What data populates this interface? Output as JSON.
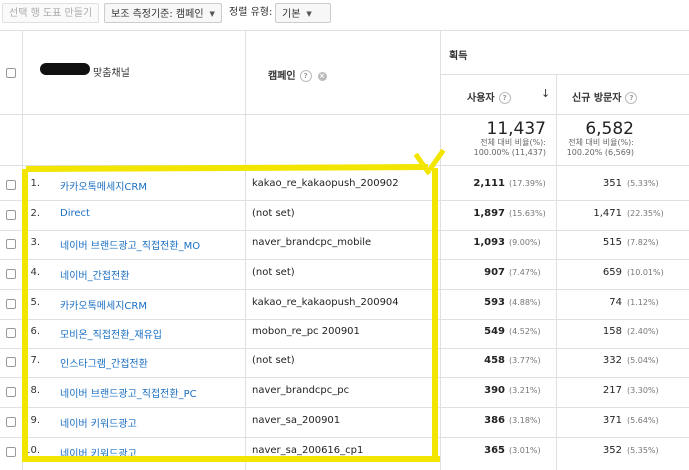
{
  "toolbar": {
    "make_chart_label": "선택 행 도표 만들기",
    "secondary_dimension_label": "보조 측정기준: 캠페인",
    "sort_type_label": "정렬 유형:",
    "sort_type_value": "기본"
  },
  "header": {
    "group_label": "획득",
    "col_channel": "맞춤채널",
    "col_campaign": "캠페인",
    "col_users": "사용자",
    "col_new_visitors": "신규 방문자"
  },
  "totals": {
    "users_value": "11,437",
    "users_line1": "전체 대비 비율(%):",
    "users_line2": "100.00% (11,437)",
    "new_value": "6,582",
    "new_line1": "전체 대비 비율(%):",
    "new_line2": "100.20% (6,569)"
  },
  "rows": [
    {
      "num": "1.",
      "channel": "카카오톡메세지CRM",
      "campaign": "kakao_re_kakaopush_200902",
      "users": "2,111",
      "users_pct": "(17.39%)",
      "new": "351",
      "new_pct": "(5.33%)"
    },
    {
      "num": "2.",
      "channel": "Direct",
      "campaign": "(not set)",
      "users": "1,897",
      "users_pct": "(15.63%)",
      "new": "1,471",
      "new_pct": "(22.35%)"
    },
    {
      "num": "3.",
      "channel": "네이버 브랜드광고_직접전환_MO",
      "campaign": "naver_brandcpc_mobile",
      "users": "1,093",
      "users_pct": "(9.00%)",
      "new": "515",
      "new_pct": "(7.82%)"
    },
    {
      "num": "4.",
      "channel": "네이버_간접전환",
      "campaign": "(not set)",
      "users": "907",
      "users_pct": "(7.47%)",
      "new": "659",
      "new_pct": "(10.01%)"
    },
    {
      "num": "5.",
      "channel": "카카오톡메세지CRM",
      "campaign": "kakao_re_kakaopush_200904",
      "users": "593",
      "users_pct": "(4.88%)",
      "new": "74",
      "new_pct": "(1.12%)"
    },
    {
      "num": "6.",
      "channel": "모비온_직접전환_재유입",
      "campaign": "mobon_re_pc 200901",
      "users": "549",
      "users_pct": "(4.52%)",
      "new": "158",
      "new_pct": "(2.40%)"
    },
    {
      "num": "7.",
      "channel": "인스타그램_간접전환",
      "campaign": "(not set)",
      "users": "458",
      "users_pct": "(3.77%)",
      "new": "332",
      "new_pct": "(5.04%)"
    },
    {
      "num": "8.",
      "channel": "네이버 브랜드광고_직접전환_PC",
      "campaign": "naver_brandcpc_pc",
      "users": "390",
      "users_pct": "(3.21%)",
      "new": "217",
      "new_pct": "(3.30%)"
    },
    {
      "num": "9.",
      "channel": "네이버 키워드광고",
      "campaign": "naver_sa_200901",
      "users": "386",
      "users_pct": "(3.18%)",
      "new": "371",
      "new_pct": "(5.64%)"
    },
    {
      "num": "10.",
      "channel": "네이버 키워드광고",
      "campaign": "naver_sa_200616_cp1",
      "users": "365",
      "users_pct": "(3.01%)",
      "new": "352",
      "new_pct": "(5.35%)"
    }
  ],
  "colors": {
    "highlight": "#f2e600",
    "link": "#1a6fc2"
  }
}
